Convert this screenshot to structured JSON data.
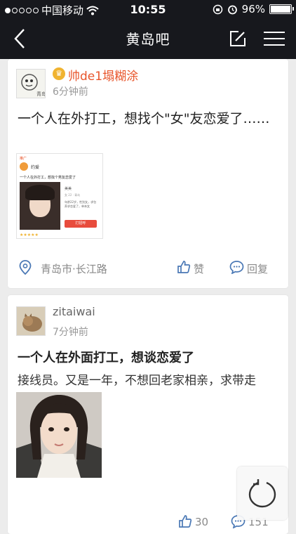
{
  "status_bar": {
    "carrier": "中国移动",
    "time": "10:55",
    "battery": "96%"
  },
  "nav": {
    "title": "黄岛吧"
  },
  "posts": [
    {
      "username": "帅de1塌糊涂",
      "time": "6分钟前",
      "title": "一个人在外打工，想找个\"女\"友恋爱了……",
      "location": "青岛市·长江路",
      "like_label": "赞",
      "reply_label": "回复",
      "image_text": {
        "tag": "推广",
        "name": "约爱",
        "headline": "一个人在外打工，想找个男友恋爱了",
        "profile_name": "美美",
        "profile_meta": "女 22 · 青岛",
        "profile_bio": "年龄22岁，性别女，求包养求恋爱了，单亲女",
        "call_button": "打招呼"
      }
    },
    {
      "username": "zitaiwai",
      "time": "7分钟前",
      "title": "一个人在外面打工，想谈恋爱了",
      "body": "接线员。又是一年，不想回老家相亲，求带走",
      "likes": "30",
      "replies": "151"
    }
  ],
  "icons": {
    "back": "chevron-left-icon",
    "edit": "edit-icon",
    "menu": "menu-icon",
    "location": "location-pin-icon",
    "like": "thumbs-up-icon",
    "comment": "comment-icon",
    "refresh": "refresh-icon"
  },
  "colors": {
    "nav_bg": "#17181d",
    "username_highlight": "#e8552b",
    "icon_blue": "#4a78b5"
  }
}
